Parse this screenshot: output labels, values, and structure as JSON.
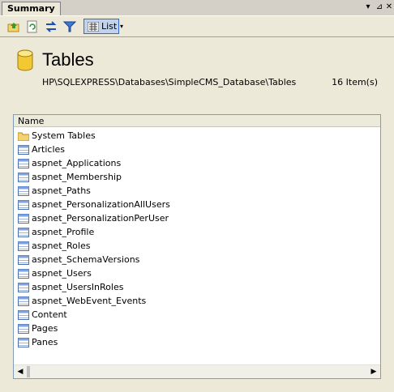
{
  "tab": {
    "label": "Summary"
  },
  "toolbar": {
    "list_label": "List"
  },
  "summary": {
    "title": "Tables",
    "path": "HP\\SQLEXPRESS\\Databases\\SimpleCMS_Database\\Tables",
    "count": "16 Item(s)"
  },
  "list": {
    "header": "Name",
    "items": [
      {
        "label": "System Tables",
        "icon": "folder-icon"
      },
      {
        "label": "Articles",
        "icon": "table-icon"
      },
      {
        "label": "aspnet_Applications",
        "icon": "table-icon"
      },
      {
        "label": "aspnet_Membership",
        "icon": "table-icon"
      },
      {
        "label": "aspnet_Paths",
        "icon": "table-icon"
      },
      {
        "label": "aspnet_PersonalizationAllUsers",
        "icon": "table-icon"
      },
      {
        "label": "aspnet_PersonalizationPerUser",
        "icon": "table-icon"
      },
      {
        "label": "aspnet_Profile",
        "icon": "table-icon"
      },
      {
        "label": "aspnet_Roles",
        "icon": "table-icon"
      },
      {
        "label": "aspnet_SchemaVersions",
        "icon": "table-icon"
      },
      {
        "label": "aspnet_Users",
        "icon": "table-icon"
      },
      {
        "label": "aspnet_UsersInRoles",
        "icon": "table-icon"
      },
      {
        "label": "aspnet_WebEvent_Events",
        "icon": "table-icon"
      },
      {
        "label": "Content",
        "icon": "table-icon"
      },
      {
        "label": "Pages",
        "icon": "table-icon"
      },
      {
        "label": "Panes",
        "icon": "table-icon"
      }
    ]
  }
}
